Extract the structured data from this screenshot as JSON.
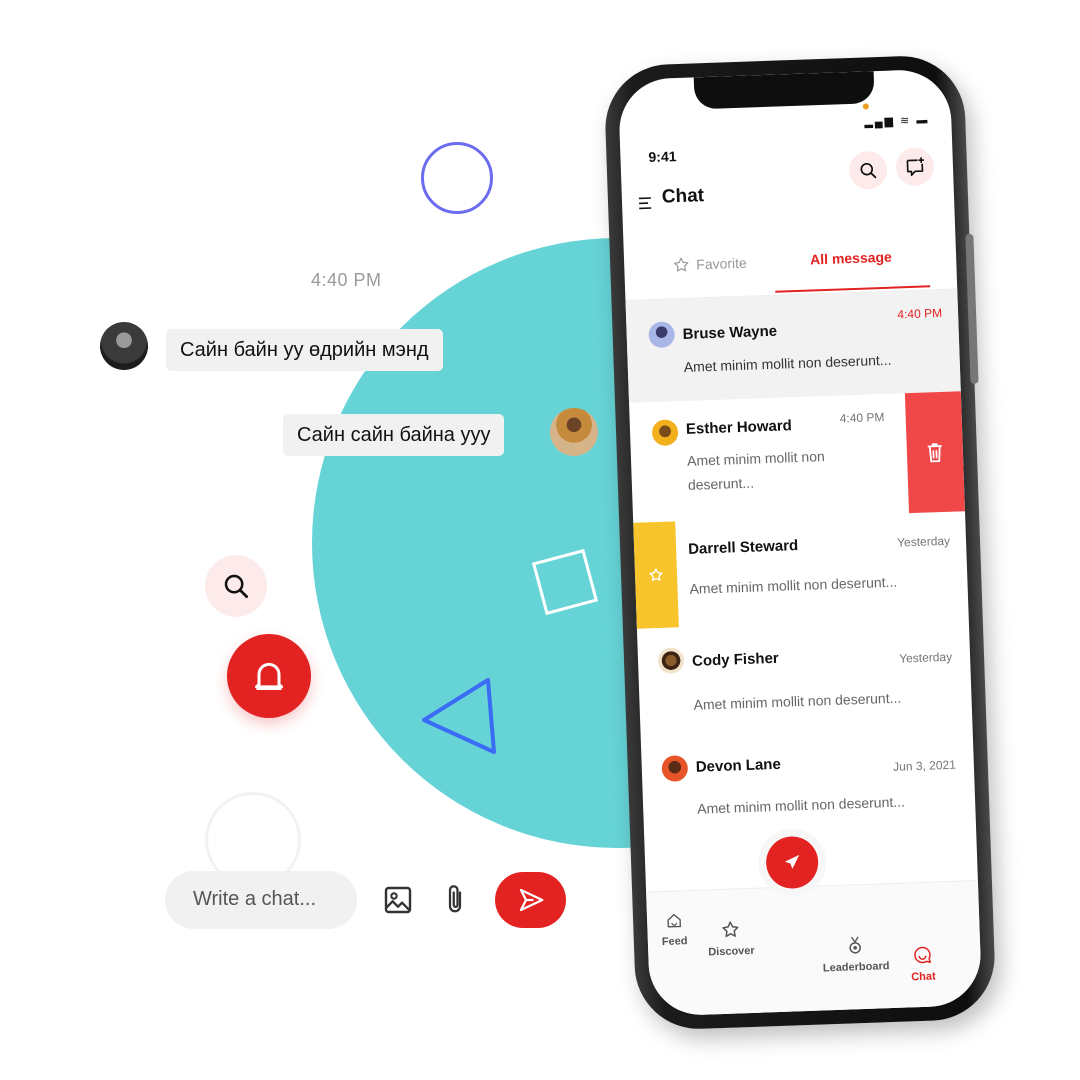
{
  "left_chat": {
    "timestamp": "4:40 PM",
    "messages": [
      {
        "text": "Сайн байн уу өдрийн мэнд",
        "side": "left"
      },
      {
        "text": "Сайн сайн байна ууу",
        "side": "right"
      }
    ],
    "composer": {
      "placeholder": "Write a chat..."
    }
  },
  "phone": {
    "status_time": "9:41",
    "status_icons": "▂▄▆ ≋ ▬",
    "header": {
      "title": "Chat"
    },
    "tabs": [
      {
        "label": "Favorite",
        "active": false
      },
      {
        "label": "All message",
        "active": true
      }
    ],
    "conversations": [
      {
        "name": "Bruse Wayne",
        "time": "4:40 PM",
        "preview": "Amet minim mollit non deserunt...",
        "selected": true
      },
      {
        "name": "Esther Howard",
        "time": "4:40 PM",
        "preview": "Amet minim mollit non deserunt..."
      },
      {
        "name": "Darrell Steward",
        "time": "Yesterday",
        "preview": "Amet minim mollit non deserunt..."
      },
      {
        "name": "Cody Fisher",
        "time": "Yesterday",
        "preview": "Amet minim mollit non deserunt..."
      },
      {
        "name": "Devon Lane",
        "time": "Jun 3, 2021",
        "preview": "Amet minim mollit non deserunt..."
      }
    ],
    "nav": [
      {
        "label": "Feed",
        "icon": "home-icon"
      },
      {
        "label": "Discover",
        "icon": "star-icon"
      },
      {
        "label": "Leaderboard",
        "icon": "medal-icon"
      },
      {
        "label": "Chat",
        "icon": "chat-icon",
        "active": true
      }
    ]
  },
  "colors": {
    "accent": "#e32222",
    "teal": "#66d3d6",
    "favorite": "#f7c52b",
    "delete": "#f04848"
  }
}
